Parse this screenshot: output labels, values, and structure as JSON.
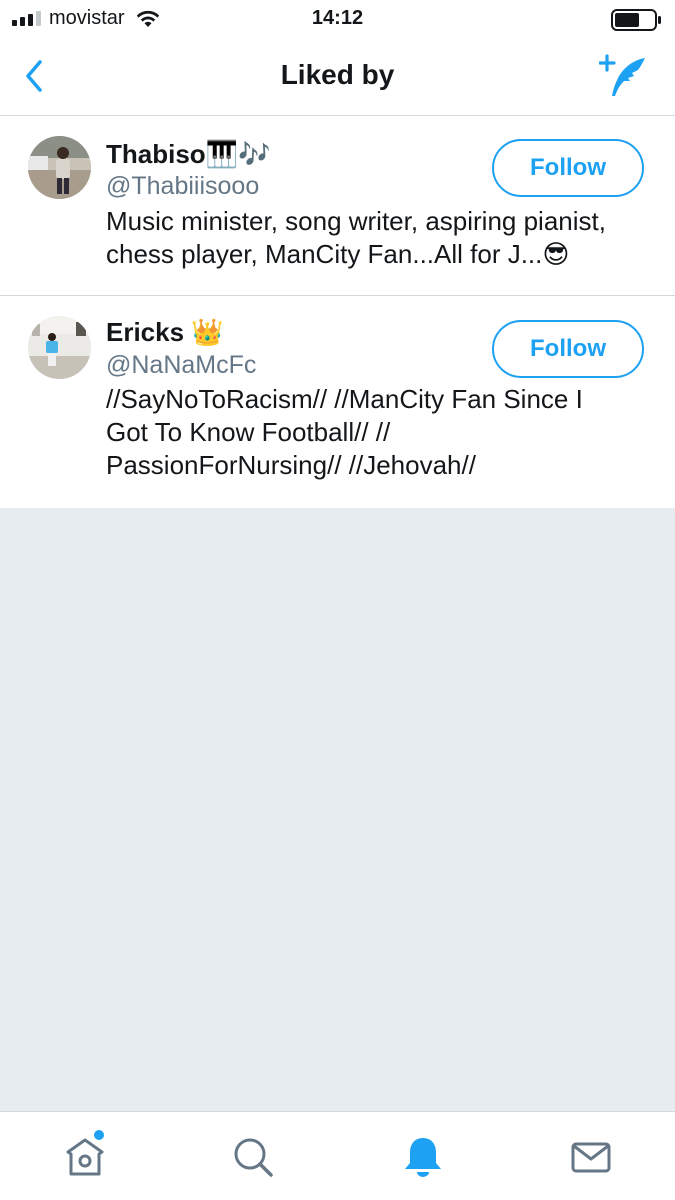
{
  "status_bar": {
    "carrier": "movistar",
    "time": "14:12"
  },
  "navbar": {
    "title": "Liked by",
    "back_icon": "chevron-left-icon",
    "compose_icon": "quill-add-icon"
  },
  "colors": {
    "accent": "#1da1f2",
    "background": "#e6ecf0",
    "secondary_text": "#657786",
    "divider": "#d2d8dc"
  },
  "users": [
    {
      "name": "Thabiso",
      "name_emoji": "🎹🎶",
      "handle": "@Thabiiisooo",
      "bio": "Music minister, song writer, aspiring pianist, chess player, ManCity Fan...All for J...",
      "bio_emoji": "😎",
      "follow_label": "Follow"
    },
    {
      "name": "Ericks",
      "name_emoji": "👑",
      "handle": "@NaNaMcFc",
      "bio": "//SayNoToRacism// //ManCity Fan Since I Got To Know Football// // PassionForNursing// //Jehovah//",
      "bio_emoji": "",
      "follow_label": "Follow"
    }
  ],
  "tabbar": {
    "tabs": [
      {
        "icon": "home-icon",
        "has_dot": true
      },
      {
        "icon": "search-icon",
        "has_dot": false
      },
      {
        "icon": "bell-icon",
        "active": true
      },
      {
        "icon": "mail-icon",
        "has_dot": false
      }
    ]
  }
}
